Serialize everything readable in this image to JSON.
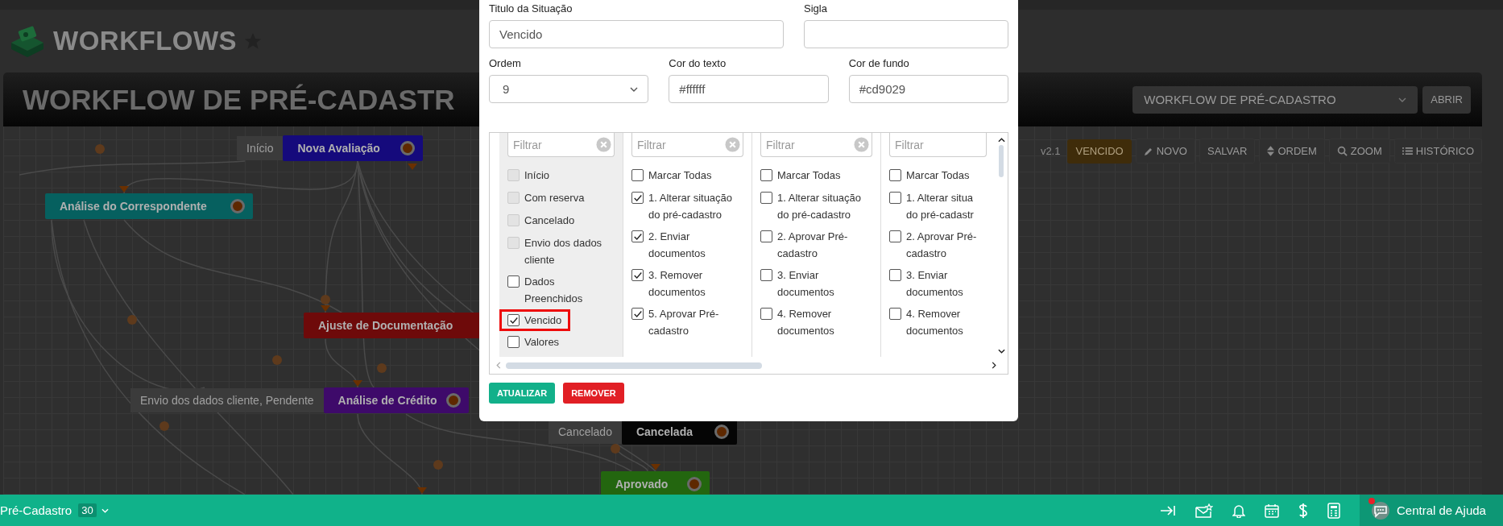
{
  "header": {
    "title": "WORKFLOWS"
  },
  "banner": {
    "title": "WORKFLOW DE PRÉ-CADASTR",
    "workflow_select": "WORKFLOW DE PRÉ-CADASTRO",
    "open_button": "ABRIR"
  },
  "toolbar": {
    "version": "v2.1",
    "status_badge": {
      "label": "VENCIDO",
      "color": "#3f2c0a"
    },
    "buttons": [
      {
        "kind": "edit",
        "label": "NOVO"
      },
      {
        "kind": "plain",
        "label": "SALVAR"
      },
      {
        "kind": "sort",
        "label": "ORDEM"
      },
      {
        "kind": "search",
        "label": "ZOOM"
      },
      {
        "kind": "list",
        "label": "HISTÓRICO"
      }
    ]
  },
  "canvas": {
    "nodes": [
      {
        "label": "Nova Avaliação",
        "color": "#150a7c",
        "tag": "Início"
      },
      {
        "label": "Análise do Correspondente",
        "color": "#06605f"
      },
      {
        "label": "Ajuste de Documentação",
        "color": "#6e0a0a"
      },
      {
        "label": "Análise de Crédito",
        "color": "#3e0a6a",
        "tag": "Envio dos dados cliente, Pendente"
      },
      {
        "label": "Cancelada",
        "color": "#050505",
        "tag": "Cancelado"
      },
      {
        "label": "Aprovado",
        "color": "#23660f"
      }
    ]
  },
  "modal": {
    "fields": [
      {
        "label": "Titulo da Situação",
        "kind": "text",
        "value": "Vencido"
      },
      {
        "label": "Sigla",
        "kind": "text"
      },
      {
        "label": "Ordem",
        "kind": "select",
        "value": "9"
      },
      {
        "label": "Cor do texto",
        "kind": "text",
        "value": "#ffffff"
      },
      {
        "label": "Cor de fundo",
        "kind": "text",
        "value": "#cd9029"
      }
    ],
    "lists": [
      {
        "filter_placeholder": "Filtrar",
        "clearable": true,
        "shaded": true,
        "items": [
          {
            "label": "Início",
            "checked": false,
            "disabled": true,
            "highlighted": false
          },
          {
            "label": "Com reserva",
            "checked": false,
            "disabled": true,
            "highlighted": false
          },
          {
            "label": "Cancelado",
            "checked": false,
            "disabled": true,
            "highlighted": false
          },
          {
            "label": "Envio dos dados cliente",
            "checked": false,
            "disabled": true,
            "highlighted": false
          },
          {
            "label": "Dados Preenchidos",
            "checked": false,
            "disabled": false,
            "highlighted": false
          },
          {
            "label": "Vencido",
            "checked": true,
            "disabled": false,
            "highlighted": true
          },
          {
            "label": "Valores",
            "checked": false,
            "disabled": false,
            "highlighted": false
          }
        ]
      },
      {
        "filter_placeholder": "Filtrar",
        "clearable": true,
        "shaded": false,
        "items": [
          {
            "label": "Marcar Todas",
            "checked": false,
            "disabled": false,
            "highlighted": false
          },
          {
            "label": "1. Alterar situação do pré-cadastro",
            "checked": true,
            "disabled": false,
            "highlighted": false
          },
          {
            "label": "2. Enviar documentos",
            "checked": true,
            "disabled": false,
            "highlighted": false
          },
          {
            "label": "3. Remover documentos",
            "checked": true,
            "disabled": false,
            "highlighted": false
          },
          {
            "label": "5. Aprovar Pré-cadastro",
            "checked": true,
            "disabled": false,
            "highlighted": false
          }
        ]
      },
      {
        "filter_placeholder": "Filtrar",
        "clearable": true,
        "shaded": false,
        "items": [
          {
            "label": "Marcar Todas",
            "checked": false,
            "disabled": false,
            "highlighted": false
          },
          {
            "label": "1. Alterar situação do pré-cadastro",
            "checked": false,
            "disabled": false,
            "highlighted": false
          },
          {
            "label": "2. Aprovar Pré-cadastro",
            "checked": false,
            "disabled": false,
            "highlighted": false
          },
          {
            "label": "3. Enviar documentos",
            "checked": false,
            "disabled": false,
            "highlighted": false
          },
          {
            "label": "4. Remover documentos",
            "checked": false,
            "disabled": false,
            "highlighted": false
          }
        ]
      },
      {
        "filter_placeholder": "Filtrar",
        "clearable": false,
        "shaded": false,
        "items": [
          {
            "label": "Marcar Todas",
            "checked": false,
            "disabled": false,
            "highlighted": false
          },
          {
            "label": "1. Alterar situa do pré-cadastr",
            "checked": false,
            "disabled": false,
            "highlighted": false
          },
          {
            "label": "2. Aprovar Pré-cadastro",
            "checked": false,
            "disabled": false,
            "highlighted": false
          },
          {
            "label": "3. Enviar documentos",
            "checked": false,
            "disabled": false,
            "highlighted": false
          },
          {
            "label": "4. Remover documentos",
            "checked": false,
            "disabled": false,
            "highlighted": false
          }
        ]
      }
    ],
    "actions": [
      {
        "label": "ATUALIZAR",
        "kind": "primary"
      },
      {
        "label": "REMOVER",
        "kind": "danger"
      }
    ]
  },
  "status_bar": {
    "module": "Pré-Cadastro",
    "count": "30",
    "help": "Central de Ajuda",
    "notification": true
  }
}
